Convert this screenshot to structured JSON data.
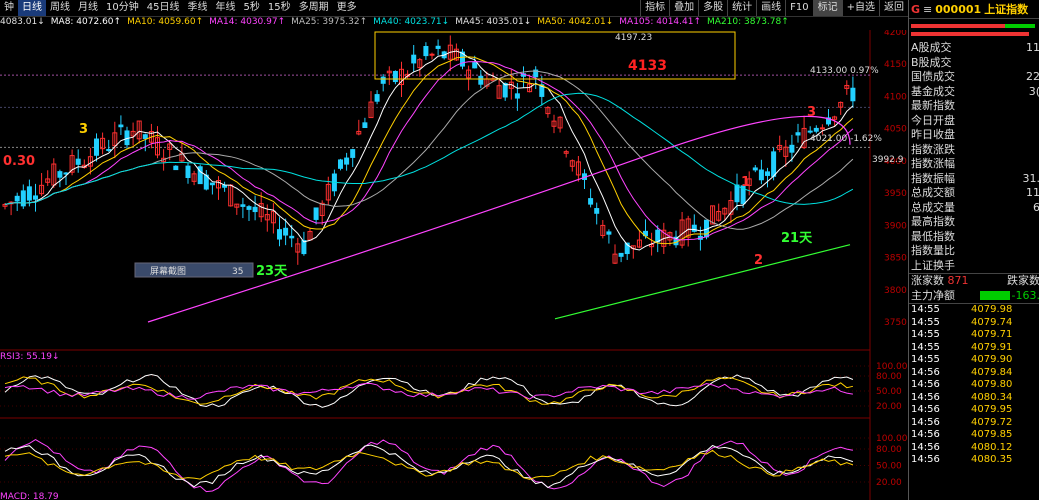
{
  "toolbar": {
    "periods": [
      "钟",
      "日线",
      "周线",
      "月线",
      "10分钟",
      "45日线",
      "季线",
      "年线",
      "5秒",
      "15秒",
      "多周期",
      "更多"
    ],
    "active_period": "日线",
    "tools": [
      "指标",
      "叠加",
      "多股",
      "统计",
      "画线",
      "F10",
      "标记",
      "+自选",
      "返回"
    ]
  },
  "ma_line": [
    {
      "text": "4083.01↓",
      "color": "#e0e0e0"
    },
    {
      "text": "MA8: 4072.60↑",
      "color": "#ffffff"
    },
    {
      "text": "MA10: 4059.60↑",
      "color": "#ffd000"
    },
    {
      "text": "MA14: 4030.97↑",
      "color": "#ff44ff"
    },
    {
      "text": "MA25: 3975.32↑",
      "color": "#bbbbbb"
    },
    {
      "text": "MA40: 4023.71↓",
      "color": "#00e0e0"
    },
    {
      "text": "MA45: 4035.01↓",
      "color": "#e0e0e0"
    },
    {
      "text": "MA50: 4042.01↓",
      "color": "#ffd000"
    },
    {
      "text": "MA105: 4014.41↑",
      "color": "#ff44ff"
    },
    {
      "text": "MA210: 3873.78↑",
      "color": "#33ff33"
    }
  ],
  "price_axis": [
    "4200",
    "4150",
    "4100",
    "4050",
    "4000",
    "3950",
    "3900",
    "3850",
    "3800",
    "3750"
  ],
  "rsi_axis": [
    "100.00",
    "80.00",
    "50.00",
    "20.00"
  ],
  "kdj_axis": [
    "100.00",
    "80.00",
    "50.00",
    "20.00"
  ],
  "annotations": {
    "high": "4197.23",
    "level_label": "4133",
    "level_value": "4133.00 0.97%",
    "mid_value": "4021.00 -1.62%",
    "right_value": "3992.9",
    "left_value": "0.30",
    "num3_left": "3",
    "num3_right": "3",
    "num1": "1",
    "num2": "2",
    "days23": "23天",
    "days21": "21天",
    "screenshot_label": "屏幕截图",
    "screenshot_value": "35",
    "rsi_label": "RSI3: 55.19↓",
    "macd_label": "MACD: 18.79"
  },
  "panel": {
    "g": "G",
    "menu": "≡",
    "code": "000001",
    "name": "上证指数",
    "stats": [
      {
        "label": "A股成交",
        "value": "11"
      },
      {
        "label": "B股成交",
        "value": ""
      },
      {
        "label": "国债成交",
        "value": "22"
      },
      {
        "label": "基金成交",
        "value": "3("
      },
      {
        "label": "最新指数",
        "value": ""
      },
      {
        "label": "今日开盘",
        "value": ""
      },
      {
        "label": "昨日收盘",
        "value": ""
      },
      {
        "label": "指数涨跌",
        "value": ""
      },
      {
        "label": "指数涨幅",
        "value": ""
      },
      {
        "label": "指数振幅",
        "value": "31."
      },
      {
        "label": "总成交额",
        "value": "11"
      },
      {
        "label": "总成交量",
        "value": "6"
      },
      {
        "label": "最高指数",
        "value": ""
      },
      {
        "label": "最低指数",
        "value": ""
      },
      {
        "label": "指数量比",
        "value": ""
      },
      {
        "label": "上证换手",
        "value": ""
      }
    ],
    "advance_label": "涨家数",
    "advance_value": "871",
    "decline_label": "跌家数",
    "netflow_label": "主力净额",
    "netflow_value": "-163.",
    "ticks": [
      {
        "time": "14:55",
        "price": "4079.98"
      },
      {
        "time": "14:55",
        "price": "4079.74"
      },
      {
        "time": "14:55",
        "price": "4079.71"
      },
      {
        "time": "14:55",
        "price": "4079.91"
      },
      {
        "time": "14:55",
        "price": "4079.90"
      },
      {
        "time": "14:56",
        "price": "4079.84"
      },
      {
        "time": "14:56",
        "price": "4079.80"
      },
      {
        "time": "14:56",
        "price": "4080.34"
      },
      {
        "time": "14:56",
        "price": "4079.95"
      },
      {
        "time": "14:56",
        "price": "4079.72"
      },
      {
        "time": "14:56",
        "price": "4079.85"
      },
      {
        "time": "14:56",
        "price": "4080.12"
      },
      {
        "time": "14:56",
        "price": "4080.35"
      }
    ]
  }
}
